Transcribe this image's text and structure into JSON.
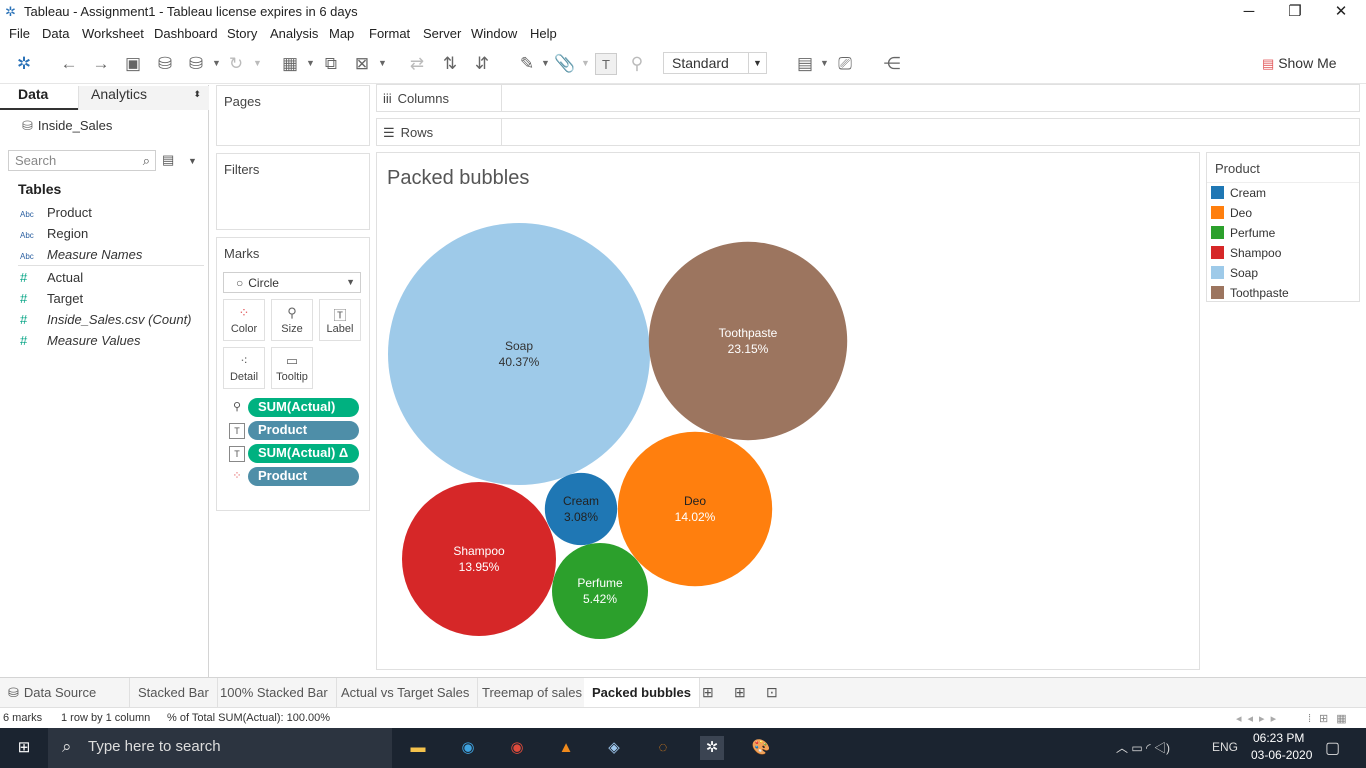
{
  "window": {
    "title": "Tableau - Assignment1 - Tableau license expires in 6 days",
    "min": "─",
    "max": "❐",
    "close": "✕"
  },
  "menu": [
    "File",
    "Data",
    "Worksheet",
    "Dashboard",
    "Story",
    "Analysis",
    "Map",
    "Format",
    "Server",
    "Window",
    "Help"
  ],
  "toolbar": {
    "fit": "Standard",
    "show_me": "Show Me"
  },
  "left_pane": {
    "tab_data": "Data",
    "tab_analytics": "Analytics",
    "datasource": "Inside_Sales",
    "search_placeholder": "Search",
    "tables_heading": "Tables",
    "fields": [
      {
        "icon": "Abc",
        "name": "Product"
      },
      {
        "icon": "Abc",
        "name": "Region"
      },
      {
        "icon": "Abc",
        "name": "Measure Names"
      },
      {
        "icon": "#",
        "name": "Actual"
      },
      {
        "icon": "#",
        "name": "Target"
      },
      {
        "icon": "#",
        "name": "Inside_Sales.csv (Count)"
      },
      {
        "icon": "#",
        "name": "Measure Values"
      }
    ]
  },
  "cards": {
    "pages": "Pages",
    "filters": "Filters",
    "marks": "Marks",
    "mark_type": "Circle",
    "buttons": [
      "Color",
      "Size",
      "Label",
      "Detail",
      "Tooltip"
    ],
    "pills": [
      "SUM(Actual)",
      "Product",
      "SUM(Actual) Δ",
      "Product"
    ]
  },
  "shelves": {
    "columns": "Columns",
    "rows": "Rows"
  },
  "viz": {
    "title": "Packed bubbles"
  },
  "legend": {
    "title": "Product",
    "items": [
      {
        "label": "Cream",
        "color": "#1f77b4"
      },
      {
        "label": "Deo",
        "color": "#ff7f0e"
      },
      {
        "label": "Perfume",
        "color": "#2ca02c"
      },
      {
        "label": "Shampoo",
        "color": "#d62728"
      },
      {
        "label": "Soap",
        "color": "#9ecae9"
      },
      {
        "label": "Toothpaste",
        "color": "#9c755f"
      }
    ]
  },
  "chart_data": {
    "type": "packed-bubble",
    "title": "Packed bubbles",
    "size_measure": "SUM(Actual)",
    "color_dimension": "Product",
    "bubbles": [
      {
        "product": "Soap",
        "percent": "40.37%",
        "value": 40.37,
        "color": "#9ecae9"
      },
      {
        "product": "Toothpaste",
        "percent": "23.15%",
        "value": 23.15,
        "color": "#9c755f"
      },
      {
        "product": "Deo",
        "percent": "14.02%",
        "value": 14.02,
        "color": "#ff7f0e"
      },
      {
        "product": "Shampoo",
        "percent": "13.95%",
        "value": 13.95,
        "color": "#d62728"
      },
      {
        "product": "Perfume",
        "percent": "5.42%",
        "value": 5.42,
        "color": "#2ca02c"
      },
      {
        "product": "Cream",
        "percent": "3.08%",
        "value": 3.08,
        "color": "#1f77b4"
      }
    ]
  },
  "sheet_tabs": [
    "Data Source",
    "Stacked Bar",
    "100% Stacked Bar",
    "Actual vs Target Sales",
    "Treemap of sales",
    "Packed bubbles"
  ],
  "status": {
    "marks": "6 marks",
    "layout": "1 row by 1 column",
    "total": "% of Total SUM(Actual): 100.00%"
  },
  "taskbar": {
    "search": "Type here to search",
    "time": "06:23 PM",
    "date": "03-06-2020",
    "lang": "ENG"
  }
}
